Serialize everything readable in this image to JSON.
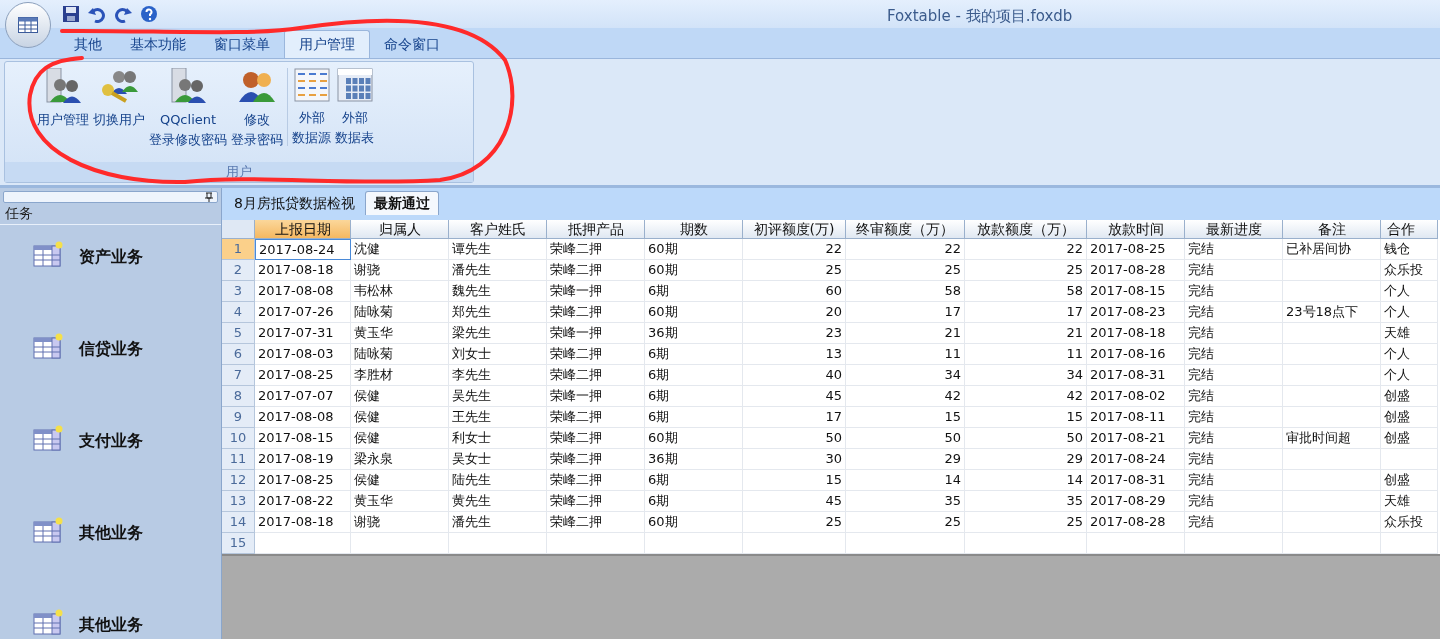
{
  "title_bar": {
    "title": "Foxtable - 我的项目.foxdb"
  },
  "ribbon": {
    "tabs": [
      {
        "label": "其他",
        "selected": false
      },
      {
        "label": "基本功能",
        "selected": false
      },
      {
        "label": "窗口菜单",
        "selected": false
      },
      {
        "label": "用户管理",
        "selected": true
      },
      {
        "label": "命令窗口",
        "selected": false
      }
    ],
    "group": {
      "label": "用户",
      "buttons": [
        {
          "kind": "users",
          "lines": [
            "用户管理"
          ],
          "separator_before": false
        },
        {
          "kind": "key",
          "lines": [
            "切换用户"
          ],
          "separator_before": false
        },
        {
          "kind": "users",
          "lines": [
            "QQclient",
            "登录修改密码"
          ],
          "separator_before": false
        },
        {
          "kind": "people",
          "lines": [
            "修改",
            "登录密码"
          ],
          "separator_before": false
        },
        {
          "kind": "grid",
          "lines": [
            "外部",
            "数据源"
          ],
          "separator_before": true
        },
        {
          "kind": "table",
          "lines": [
            "外部",
            "数据表"
          ],
          "separator_before": false
        }
      ]
    }
  },
  "sidebar": {
    "title": "任务",
    "items": [
      "资产业务",
      "信贷业务",
      "支付业务",
      "其他业务",
      "其他业务"
    ]
  },
  "doc_tabs": [
    {
      "label": "8月房抵贷数据检视",
      "selected": false
    },
    {
      "label": "最新通过",
      "selected": true
    }
  ],
  "table": {
    "columns": [
      {
        "label": "上报日期",
        "kind": "text",
        "selected": true
      },
      {
        "label": "归属人",
        "kind": "text",
        "selected": false
      },
      {
        "label": "客户姓氏",
        "kind": "text",
        "selected": false
      },
      {
        "label": "抵押产品",
        "kind": "text",
        "selected": false
      },
      {
        "label": "期数",
        "kind": "text",
        "selected": false
      },
      {
        "label": "初评额度(万)",
        "kind": "number",
        "selected": false
      },
      {
        "label": "终审额度（万）",
        "kind": "number",
        "selected": false
      },
      {
        "label": "放款额度（万）",
        "kind": "number",
        "selected": false
      },
      {
        "label": "放款时间",
        "kind": "text",
        "selected": false
      },
      {
        "label": "最新进度",
        "kind": "text",
        "selected": false
      },
      {
        "label": "备注",
        "kind": "text",
        "selected": false
      },
      {
        "label": "合作",
        "kind": "text",
        "selected": false
      }
    ],
    "rows": [
      {
        "number": "1",
        "selected": true,
        "cells": [
          "2017-08-24",
          "沈健",
          "谭先生",
          "荣峰二押",
          "60期",
          "22",
          "22",
          "22",
          "2017-08-25",
          "完结",
          "已补居间协",
          "钱仓"
        ]
      },
      {
        "number": "2",
        "selected": false,
        "cells": [
          "2017-08-18",
          "谢骁",
          "潘先生",
          "荣峰二押",
          "60期",
          "25",
          "25",
          "25",
          "2017-08-28",
          "完结",
          "",
          "众乐投"
        ]
      },
      {
        "number": "3",
        "selected": false,
        "cells": [
          "2017-08-08",
          "韦松林",
          "魏先生",
          "荣峰一押",
          "6期",
          "60",
          "58",
          "58",
          "2017-08-15",
          "完结",
          "",
          "个人"
        ]
      },
      {
        "number": "4",
        "selected": false,
        "cells": [
          "2017-07-26",
          "陆咏菊",
          "郑先生",
          "荣峰二押",
          "60期",
          "20",
          "17",
          "17",
          "2017-08-23",
          "完结",
          "23号18点下",
          "个人"
        ]
      },
      {
        "number": "5",
        "selected": false,
        "cells": [
          "2017-07-31",
          "黄玉华",
          "梁先生",
          "荣峰一押",
          "36期",
          "23",
          "21",
          "21",
          "2017-08-18",
          "完结",
          "",
          "天雄"
        ]
      },
      {
        "number": "6",
        "selected": false,
        "cells": [
          "2017-08-03",
          "陆咏菊",
          "刘女士",
          "荣峰二押",
          "6期",
          "13",
          "11",
          "11",
          "2017-08-16",
          "完结",
          "",
          "个人"
        ]
      },
      {
        "number": "7",
        "selected": false,
        "cells": [
          "2017-08-25",
          "李胜材",
          "李先生",
          "荣峰二押",
          "6期",
          "40",
          "34",
          "34",
          "2017-08-31",
          "完结",
          "",
          "个人"
        ]
      },
      {
        "number": "8",
        "selected": false,
        "cells": [
          "2017-07-07",
          "侯健",
          "吴先生",
          "荣峰一押",
          "6期",
          "45",
          "42",
          "42",
          "2017-08-02",
          "完结",
          "",
          "创盛"
        ]
      },
      {
        "number": "9",
        "selected": false,
        "cells": [
          "2017-08-08",
          "侯健",
          "王先生",
          "荣峰二押",
          "6期",
          "17",
          "15",
          "15",
          "2017-08-11",
          "完结",
          "",
          "创盛"
        ]
      },
      {
        "number": "10",
        "selected": false,
        "cells": [
          "2017-08-15",
          "侯健",
          "利女士",
          "荣峰二押",
          "60期",
          "50",
          "50",
          "50",
          "2017-08-21",
          "完结",
          "审批时间超",
          "创盛"
        ]
      },
      {
        "number": "11",
        "selected": false,
        "cells": [
          "2017-08-19",
          "梁永泉",
          "吴女士",
          "荣峰二押",
          "36期",
          "30",
          "29",
          "29",
          "2017-08-24",
          "完结",
          "",
          ""
        ]
      },
      {
        "number": "12",
        "selected": false,
        "cells": [
          "2017-08-25",
          "侯健",
          "陆先生",
          "荣峰二押",
          "6期",
          "15",
          "14",
          "14",
          "2017-08-31",
          "完结",
          "",
          "创盛"
        ]
      },
      {
        "number": "13",
        "selected": false,
        "cells": [
          "2017-08-22",
          "黄玉华",
          "黄先生",
          "荣峰二押",
          "6期",
          "45",
          "35",
          "35",
          "2017-08-29",
          "完结",
          "",
          "天雄"
        ]
      },
      {
        "number": "14",
        "selected": false,
        "cells": [
          "2017-08-18",
          "谢骁",
          "潘先生",
          "荣峰二押",
          "60期",
          "25",
          "25",
          "25",
          "2017-08-28",
          "完结",
          "",
          "众乐投"
        ]
      },
      {
        "number": "15",
        "selected": false,
        "cells": [
          "",
          "",
          "",
          "",
          "",
          "",
          "",
          "",
          "",
          "",
          "",
          ""
        ]
      }
    ]
  }
}
